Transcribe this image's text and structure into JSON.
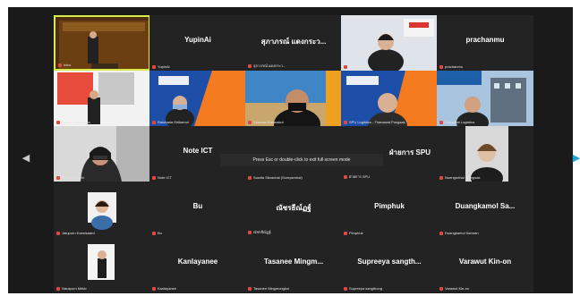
{
  "meeting": {
    "exit_hint": "Press Esc or double-click to exit full screen mode",
    "colors": {
      "background": "#1a1a1a",
      "tile": "#232323",
      "active_border": "#d9e84a",
      "muted_mic": "#e0483e"
    }
  },
  "navigation": {
    "prev_icon": "chevron-left-icon",
    "next_icon": "chevron-right-icon"
  },
  "tiles": [
    {
      "name": "",
      "label": "Intro"
    },
    {
      "name": "YupinAi",
      "label": "YupinAi"
    },
    {
      "name": "สุภาภรณ์ แดงกระว...",
      "label": "สุภาภรณ์ แดงกระว..."
    },
    {
      "name": "",
      "label": "Yupaporn..."
    },
    {
      "name": "prachanmu",
      "label": "prachanmu"
    },
    {
      "name": "",
      "label": "Sirinan Pattanasa"
    },
    {
      "name": "",
      "label": "Ratchada Sirikamol"
    },
    {
      "name": "",
      "label": "Somsak Ratanakul"
    },
    {
      "name": "",
      "label": "SPU Logistics - Thanawat Pongsak"
    },
    {
      "name": "",
      "label": "Supachai Logistics"
    },
    {
      "name": "",
      "label": "Unhpanit Inthi"
    },
    {
      "name": "Note ICT",
      "label": "Note ICT"
    },
    {
      "name": "",
      "label": "Suwita Sikrachai (Somyarnhai)"
    },
    {
      "name": "ฝ่ายการ SPU",
      "label": "ฝ่ายการ SPU"
    },
    {
      "name": "",
      "label": "Nuengruthai Wongsak"
    },
    {
      "name": "",
      "label": "Jatuporn Kaewsaard"
    },
    {
      "name": "Bu",
      "label": "Bu"
    },
    {
      "name": "ณัชรธีณ์ฏฐ์",
      "label": "ณัชรธีณ์ฏฐ์"
    },
    {
      "name": "Pimphuk",
      "label": "Pimphuk"
    },
    {
      "name": "Duangkamol Sa...",
      "label": "Duangkamol Samran"
    },
    {
      "name": "",
      "label": "Naraporn Mekin"
    },
    {
      "name": "Kanlayanee",
      "label": "Kanlayanee"
    },
    {
      "name": "Tasanee Mingm...",
      "label": "Tasanee Mingmongkol"
    },
    {
      "name": "Supreeya sangth...",
      "label": "Supreeya sangthong"
    },
    {
      "name": "Varawut Kin-on",
      "label": "Varawut Kin-on"
    }
  ]
}
